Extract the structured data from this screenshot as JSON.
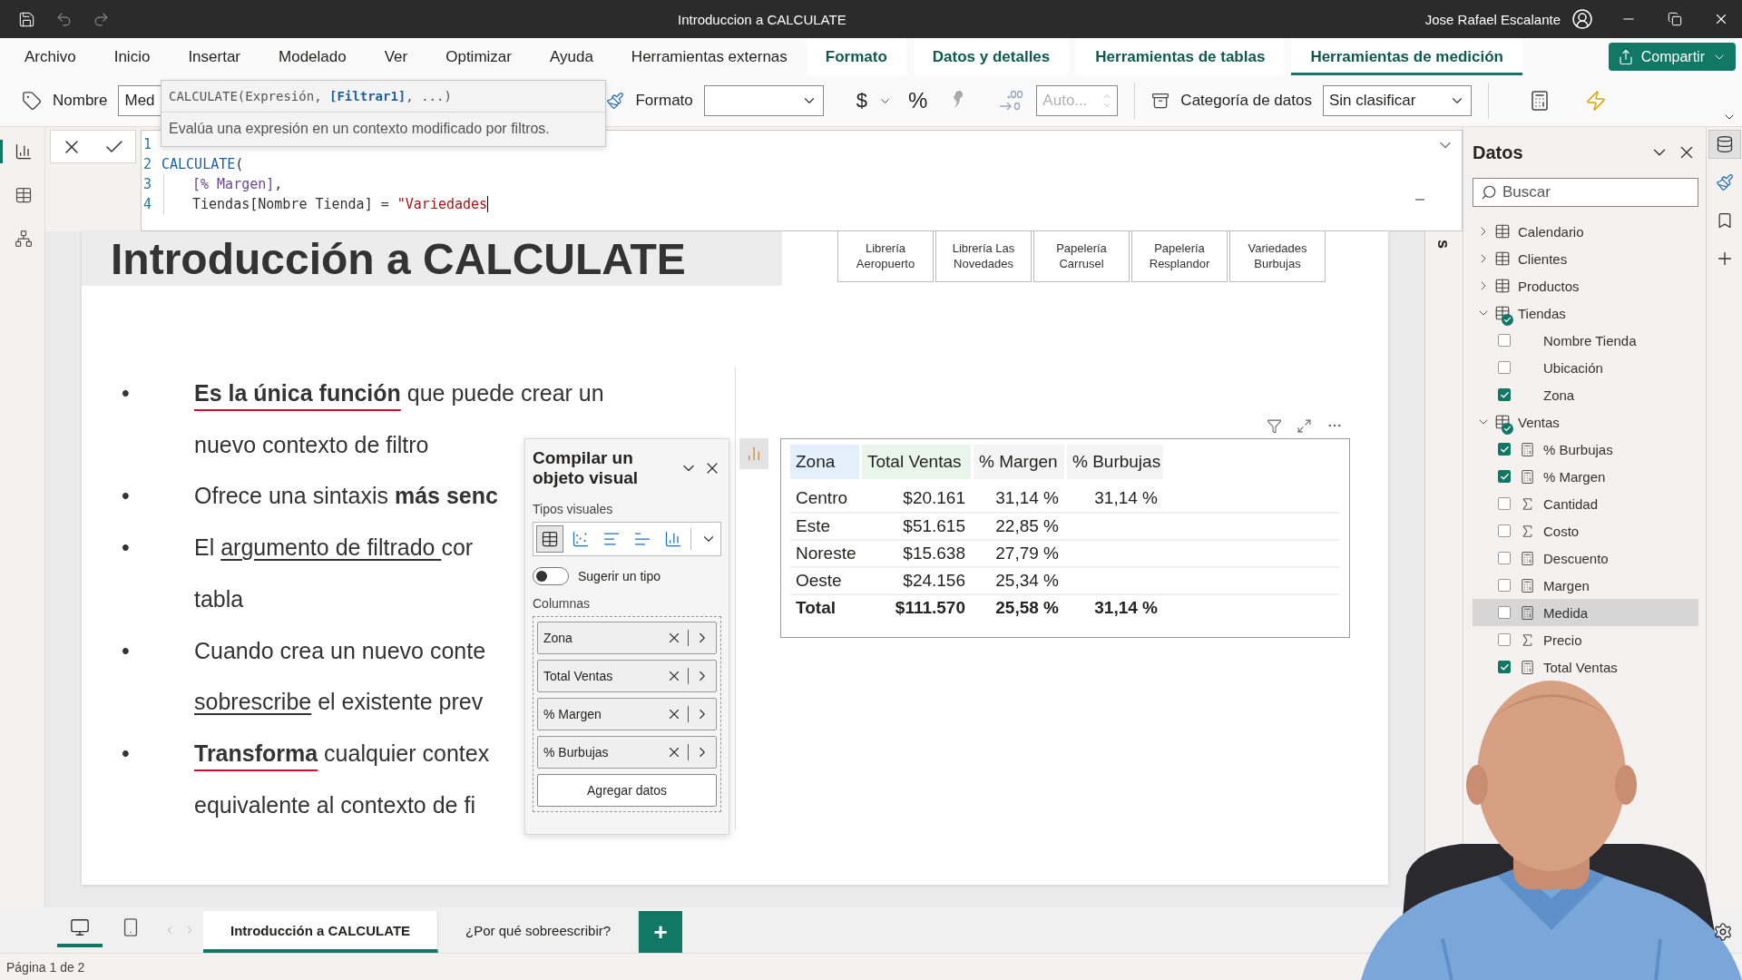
{
  "window": {
    "title": "Introduccion a CALCULATE",
    "user": "Jose Rafael Escalante"
  },
  "menu": [
    {
      "label": "Archivo",
      "kind": "plain",
      "selected": false
    },
    {
      "label": "Inicio",
      "kind": "plain",
      "selected": false
    },
    {
      "label": "Insertar",
      "kind": "plain",
      "selected": false
    },
    {
      "label": "Modelado",
      "kind": "plain",
      "selected": false
    },
    {
      "label": "Ver",
      "kind": "plain",
      "selected": false
    },
    {
      "label": "Optimizar",
      "kind": "plain",
      "selected": false
    },
    {
      "label": "Ayuda",
      "kind": "plain",
      "selected": false
    },
    {
      "label": "Herramientas externas",
      "kind": "plain",
      "selected": false
    },
    {
      "label": "Formato",
      "kind": "contextual",
      "selected": false
    },
    {
      "label": "Datos y detalles",
      "kind": "contextual",
      "selected": false
    },
    {
      "label": "Herramientas de tablas",
      "kind": "contextual",
      "selected": false
    },
    {
      "label": "Herramientas de medición",
      "kind": "contextual",
      "selected": true
    }
  ],
  "share_button": "Compartir",
  "ribbon": {
    "name_label": "Nombre",
    "name_value": "Med",
    "format_label": "Formato",
    "currency": "$",
    "percent": "%",
    "decimals_placeholder": "Auto...",
    "category_label": "Categoría de datos",
    "category_value": "Sin clasificar"
  },
  "tooltip": {
    "signature": "CALCULATE(Expresión, **[Filtrar1]**, ...)",
    "description": "Evalúa una expresión en un contexto modificado por filtros."
  },
  "formula": {
    "lines": [
      {
        "number": "1",
        "indent": false,
        "caret": false
      },
      {
        "number": "2",
        "indent": false,
        "caret": false,
        "segments": [
          {
            "kind": "function",
            "text": "CALCULATE"
          },
          {
            "kind": "plain",
            "text": "("
          }
        ]
      },
      {
        "number": "3",
        "indent": true,
        "caret": false,
        "segments": [
          {
            "kind": "measure",
            "text": "[% Margen]"
          },
          {
            "kind": "plain",
            "text": ","
          }
        ]
      },
      {
        "number": "4",
        "indent": true,
        "caret": true,
        "segments": [
          {
            "kind": "column",
            "text": "Tiendas[Nombre Tienda]"
          },
          {
            "kind": "plain",
            "text": " = "
          },
          {
            "kind": "string",
            "text": "\"Variedades"
          }
        ]
      }
    ]
  },
  "view_nav": [
    {
      "kind": "report",
      "selected": true
    },
    {
      "kind": "table",
      "selected": false
    },
    {
      "kind": "model",
      "selected": false
    }
  ],
  "slide": {
    "title": "Introducción a CALCULATE",
    "slicer": [
      {
        "label": "Librería Aeropuerto",
        "selected": false
      },
      {
        "label": "Librería Las Novedades",
        "selected": false
      },
      {
        "label": "Papelería Carrusel",
        "selected": false
      },
      {
        "label": "Papelería Resplandor",
        "selected": false
      },
      {
        "label": "Variedades Burbujas",
        "selected": false
      }
    ],
    "bullets": [
      {
        "mark": "•",
        "lines": [
          [
            {
              "kind": "ink",
              "text": "Es la única función"
            },
            {
              "kind": "plain",
              "text": " que puede crear un"
            }
          ],
          [
            {
              "kind": "plain",
              "text": "nuevo contexto de filtro"
            }
          ]
        ]
      },
      {
        "mark": "•",
        "lines": [
          [
            {
              "kind": "plain",
              "text": "Ofrece una sintaxis "
            },
            {
              "kind": "bold",
              "text": "más senc"
            }
          ]
        ]
      },
      {
        "mark": "•",
        "lines": [
          [
            {
              "kind": "plain",
              "text": "El "
            },
            {
              "kind": "underline",
              "text": "argumento de filtrado "
            },
            {
              "kind": "plain",
              "text": "cor"
            }
          ],
          [
            {
              "kind": "plain",
              "text": "tabla"
            }
          ]
        ]
      },
      {
        "mark": "•",
        "lines": [
          [
            {
              "kind": "plain",
              "text": "Cuando crea un nuevo conte"
            }
          ],
          [
            {
              "kind": "underline",
              "text": "sobrescribe"
            },
            {
              "kind": "plain",
              "text": " el existente prev"
            }
          ]
        ]
      },
      {
        "mark": "•",
        "lines": [
          [
            {
              "kind": "ink",
              "text": "Transforma"
            },
            {
              "kind": "plain",
              "text": " cualquier contex"
            }
          ],
          [
            {
              "kind": "plain",
              "text": "equivalente al contexto de fi"
            }
          ]
        ]
      }
    ]
  },
  "builder": {
    "title": "Compilar un objeto visual",
    "types_label": "Tipos visuales",
    "visual_types": [
      {
        "kind": "table",
        "selected": true
      },
      {
        "kind": "scatter",
        "selected": false
      },
      {
        "kind": "bar",
        "selected": false
      },
      {
        "kind": "stacked",
        "selected": false
      },
      {
        "kind": "column",
        "selected": false
      }
    ],
    "suggest": {
      "label": "Sugerir un tipo",
      "on": false
    },
    "columns_label": "Columnas",
    "fields": [
      "Zona",
      "Total Ventas",
      "% Margen",
      "% Burbujas"
    ],
    "add_button": "Agregar datos"
  },
  "table": {
    "columns": [
      "Zona",
      "Total Ventas",
      "% Margen",
      "% Burbujas"
    ],
    "rows": [
      [
        "Centro",
        "$20.161",
        "31,14 %",
        "31,14 %"
      ],
      [
        "Este",
        "$51.615",
        "22,85 %",
        null
      ],
      [
        "Noreste",
        "$15.638",
        "27,79 %",
        null
      ],
      [
        "Oeste",
        "$24.156",
        "25,34 %",
        null
      ]
    ],
    "total": [
      "Total",
      "$111.570",
      "25,58 %",
      "31,14 %"
    ]
  },
  "filters_pane": {
    "label": "s"
  },
  "data_pane": {
    "title": "Datos",
    "search": {
      "placeholder": "Buscar"
    },
    "tables": [
      {
        "label": "Calendario",
        "expanded": false,
        "in_use": false
      },
      {
        "label": "Clientes",
        "expanded": false,
        "in_use": false
      },
      {
        "label": "Productos",
        "expanded": false,
        "in_use": false
      },
      {
        "label": "Tiendas",
        "expanded": true,
        "in_use": true,
        "children": [
          {
            "label": "Nombre Tienda",
            "kind": "column",
            "checked": false,
            "selected": false
          },
          {
            "label": "Ubicación",
            "kind": "column",
            "checked": false,
            "selected": false
          },
          {
            "label": "Zona",
            "kind": "column",
            "checked": true,
            "selected": false
          }
        ]
      },
      {
        "label": "Ventas",
        "expanded": true,
        "in_use": true,
        "children": [
          {
            "label": "% Burbujas",
            "kind": "measure",
            "checked": true,
            "selected": false
          },
          {
            "label": "% Margen",
            "kind": "measure",
            "checked": true,
            "selected": false
          },
          {
            "label": "Cantidad",
            "kind": "sum",
            "checked": false,
            "selected": false
          },
          {
            "label": "Costo",
            "kind": "sum",
            "checked": false,
            "selected": false
          },
          {
            "label": "Descuento",
            "kind": "measure",
            "checked": false,
            "selected": false
          },
          {
            "label": "Margen",
            "kind": "measure",
            "checked": false,
            "selected": false
          },
          {
            "label": "Medida",
            "kind": "measure",
            "checked": false,
            "selected": true
          },
          {
            "label": "Precio",
            "kind": "sum",
            "checked": false,
            "selected": false
          },
          {
            "label": "Total Ventas",
            "kind": "measure",
            "checked": true,
            "selected": false
          }
        ]
      }
    ]
  },
  "rail": [
    {
      "kind": "data",
      "selected": true
    },
    {
      "kind": "format",
      "selected": false
    },
    {
      "kind": "bookmark",
      "selected": false
    },
    {
      "kind": "add",
      "selected": false
    }
  ],
  "layouts": [
    {
      "kind": "desktop",
      "selected": true
    },
    {
      "kind": "phone",
      "selected": false
    }
  ],
  "pages": [
    {
      "label": "Introducción a CALCULATE",
      "selected": true
    },
    {
      "label": "¿Por qué sobreescribir?",
      "selected": false
    }
  ],
  "add_page": "+",
  "status_bar": "Página 1 de 2"
}
